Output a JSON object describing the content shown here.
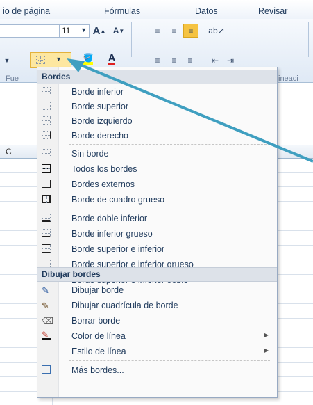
{
  "ribbon": {
    "tabs": [
      "io de página",
      "Fórmulas",
      "Datos",
      "Revisar"
    ],
    "font_size": "11",
    "group_labels": [
      "Fue",
      "ineaci"
    ],
    "column_header": "C"
  },
  "menu": {
    "sections": {
      "bordes": "Bordes",
      "dibujar": "Dibujar bordes"
    },
    "items_group1": [
      {
        "label": "Borde inferior",
        "icon": "border-bottom-icon"
      },
      {
        "label": "Borde superior",
        "icon": "border-top-icon"
      },
      {
        "label": "Borde izquierdo",
        "icon": "border-left-icon"
      },
      {
        "label": "Borde derecho",
        "icon": "border-right-icon"
      }
    ],
    "items_group2": [
      {
        "label": "Sin borde",
        "icon": "no-border-icon"
      },
      {
        "label": "Todos los bordes",
        "icon": "all-borders-icon"
      },
      {
        "label": "Bordes externos",
        "icon": "outside-borders-icon"
      },
      {
        "label": "Borde de cuadro grueso",
        "icon": "thick-box-border-icon"
      }
    ],
    "items_group3": [
      {
        "label": "Borde doble inferior",
        "icon": "double-bottom-border-icon"
      },
      {
        "label": "Borde inferior grueso",
        "icon": "thick-bottom-border-icon"
      },
      {
        "label": "Borde superior e inferior",
        "icon": "top-bottom-border-icon"
      },
      {
        "label": "Borde superior e inferior grueso",
        "icon": "top-thick-bottom-border-icon"
      },
      {
        "label": "Borde superior e inferior doble",
        "icon": "top-double-bottom-border-icon"
      }
    ],
    "draw_items": [
      {
        "label": "Dibujar borde",
        "icon": "draw-border-icon"
      },
      {
        "label": "Dibujar cuadrícula de borde",
        "icon": "draw-border-grid-icon"
      },
      {
        "label": "Borrar borde",
        "icon": "eraser-icon"
      },
      {
        "label": "Color de línea",
        "icon": "line-color-icon",
        "submenu": true
      },
      {
        "label": "Estilo de línea",
        "icon": "",
        "submenu": true
      }
    ],
    "more": {
      "label": "Más bordes...",
      "icon": "more-borders-icon"
    }
  },
  "colors": {
    "accent": "#f5c342",
    "ribbon_top": "#ffffff",
    "arrow": "#3f9fc0",
    "font_red": "#e02020"
  }
}
